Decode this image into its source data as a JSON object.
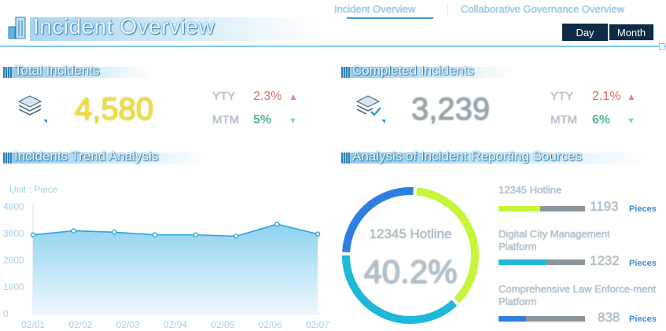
{
  "header": {
    "title": "Incident Overview",
    "nav": [
      {
        "label": "Incident Overview",
        "active": true
      },
      {
        "label": "Collaborative Governance Overview",
        "active": false
      }
    ],
    "period_buttons": [
      {
        "label": "Day"
      },
      {
        "label": "Month"
      }
    ],
    "accent_color": "#3f9ad0"
  },
  "total": {
    "title": "Total Incidents",
    "value": "4,580",
    "yty_label": "YTY",
    "yty_value": "2.3%",
    "mtm_label": "MTM",
    "mtm_value": "5%",
    "icon": "layers-icon",
    "value_color": "#f2e12c"
  },
  "completed": {
    "title": "Completed Incidents",
    "value": "3,239",
    "yty_label": "YTY",
    "yty_value": "2.1%",
    "mtm_label": "MTM",
    "mtm_value": "6%",
    "icon": "layers-check-icon",
    "value_color": "#9aa7b2"
  },
  "trend": {
    "title": "Incidents Trend Analysis",
    "unit_label": "Unit : Piece"
  },
  "sources": {
    "title": "Analysis of Incident Reporting Sources",
    "center_label": "12345 Hotline",
    "center_value": "40.2%",
    "items": [
      {
        "label": "12345 Hotline",
        "value": "1193",
        "unit": "Pieces",
        "color": "#c8f53a",
        "fill": 0.48
      },
      {
        "label": "Digital City Management Platform",
        "value": "1232",
        "unit": "Pieces",
        "color": "#1fb8d9",
        "fill": 0.55
      },
      {
        "label": "Comprehensive Law Enforce-ment Platform",
        "value": "838",
        "unit": "Pieces",
        "color": "#2f7fe0",
        "fill": 0.32
      }
    ]
  },
  "chart_data": [
    {
      "type": "area",
      "title": "",
      "xlabel": "",
      "ylabel": "Unit : Piece",
      "categories": [
        "02/01",
        "02/02",
        "02/03",
        "02/04",
        "02/05",
        "02/06",
        "02/07"
      ],
      "x": [
        "02/01",
        "02/02",
        "02/03",
        "02/04",
        "02/05",
        "02/06",
        "02/07"
      ],
      "values": [
        2950,
        3100,
        3050,
        2950,
        2950,
        2900,
        3350,
        2980
      ],
      "ylim": [
        0,
        4000
      ],
      "yticks": [
        "0",
        "1000",
        "2000",
        "3000",
        "4000"
      ],
      "grid": false,
      "color": "#5bbbe4"
    },
    {
      "type": "pie",
      "title": "",
      "categories": [
        "12345 Hotline",
        "Digital City Management Platform",
        "Comprehensive Law Enforcement Platform"
      ],
      "values": [
        1193,
        1232,
        838
      ],
      "colors": [
        "#c8f53a",
        "#1fb8d9",
        "#2f7fe0"
      ],
      "donut": true
    }
  ]
}
